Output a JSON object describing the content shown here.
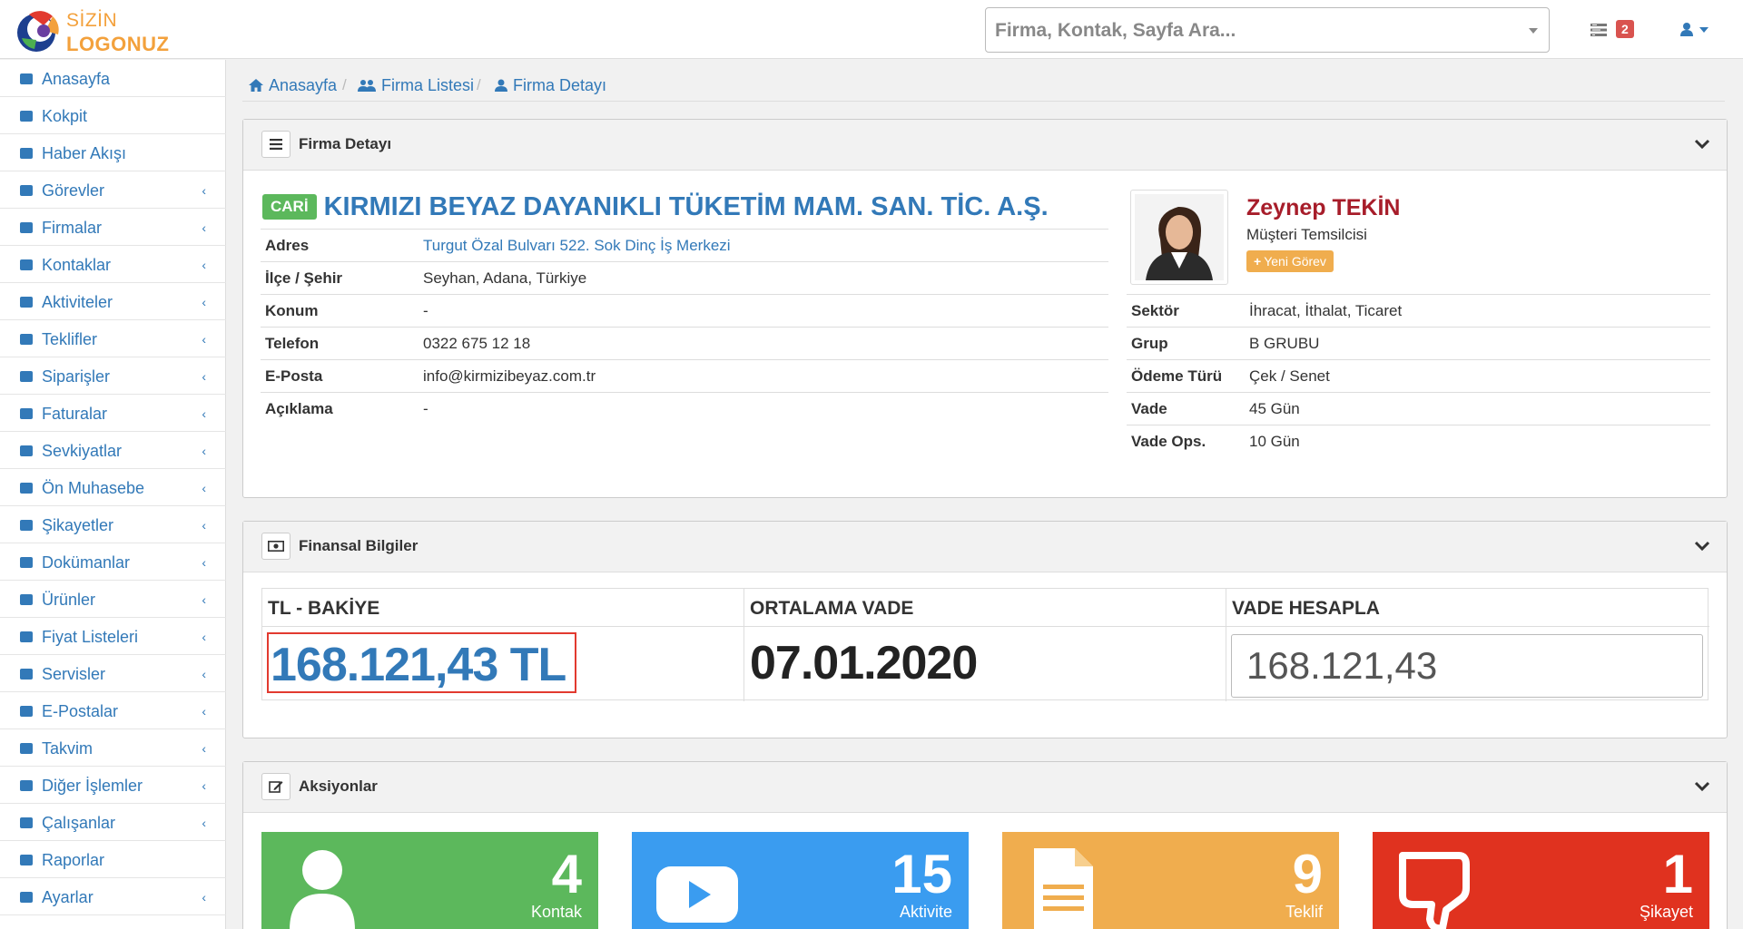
{
  "logo": {
    "line1": "SİZİN",
    "line2": "LOGONUZ"
  },
  "search": {
    "placeholder": "Firma, Kontak, Sayfa Ara..."
  },
  "notifications": {
    "count": "2"
  },
  "sidebar": {
    "items": [
      {
        "label": "Anasayfa",
        "icon": "home-icon",
        "sub": false
      },
      {
        "label": "Kokpit",
        "icon": "dashboard-icon",
        "sub": false
      },
      {
        "label": "Haber Akışı",
        "icon": "newspaper-icon",
        "sub": false
      },
      {
        "label": "Görevler",
        "icon": "tasks-icon",
        "sub": true
      },
      {
        "label": "Firmalar",
        "icon": "users-icon",
        "sub": true
      },
      {
        "label": "Kontaklar",
        "icon": "user-icon",
        "sub": true
      },
      {
        "label": "Aktiviteler",
        "icon": "youtube-play-icon",
        "sub": true
      },
      {
        "label": "Teklifler",
        "icon": "file-icon",
        "sub": true
      },
      {
        "label": "Siparişler",
        "icon": "list-alt-icon",
        "sub": true
      },
      {
        "label": "Faturalar",
        "icon": "list-icon",
        "sub": true
      },
      {
        "label": "Sevkiyatlar",
        "icon": "truck-icon",
        "sub": true
      },
      {
        "label": "Ön Muhasebe",
        "icon": "bars-icon",
        "sub": true
      },
      {
        "label": "Şikayetler",
        "icon": "thumbs-down-icon",
        "sub": true
      },
      {
        "label": "Dokümanlar",
        "icon": "document-icon",
        "sub": true
      },
      {
        "label": "Ürünler",
        "icon": "product-icon",
        "sub": true
      },
      {
        "label": "Fiyat Listeleri",
        "icon": "euro-icon",
        "sub": true
      },
      {
        "label": "Servisler",
        "icon": "wrench-icon",
        "sub": true
      },
      {
        "label": "E-Postalar",
        "icon": "envelope-icon",
        "sub": true
      },
      {
        "label": "Takvim",
        "icon": "calendar-icon",
        "sub": true
      },
      {
        "label": "Diğer İşlemler",
        "icon": "square-icon",
        "sub": true
      },
      {
        "label": "Çalışanlar",
        "icon": "employee-icon",
        "sub": true
      },
      {
        "label": "Raporlar",
        "icon": "bar-chart-icon",
        "sub": false
      },
      {
        "label": "Ayarlar",
        "icon": "gear-icon",
        "sub": true
      }
    ]
  },
  "breadcrumb": {
    "home": "Anasayfa",
    "list": "Firma Listesi",
    "detail": "Firma Detayı"
  },
  "detail_panel": {
    "title": "Firma Detayı",
    "badge": "CARİ",
    "company_name": "KIRMIZI BEYAZ DAYANIKLI TÜKETİM MAM. SAN. TİC. A.Ş.",
    "fields": [
      {
        "key": "Adres",
        "value": "Turgut Özal Bulvarı 522. Sok Dinç İş Merkezi"
      },
      {
        "key": "İlçe / Şehir",
        "value": "Seyhan, Adana, Türkiye"
      },
      {
        "key": "Konum",
        "value": "-"
      },
      {
        "key": "Telefon",
        "value": "0322 675 12 18"
      },
      {
        "key": "E-Posta",
        "value": "info@kirmizibeyaz.com.tr"
      },
      {
        "key": "Açıklama",
        "value": "-"
      }
    ],
    "rep": {
      "name": "Zeynep TEKİN",
      "title": "Müşteri Temsilcisi",
      "button": "Yeni Görev"
    },
    "extra_fields": [
      {
        "key": "Sektör",
        "value": "İhracat, İthalat, Ticaret"
      },
      {
        "key": "Grup",
        "value": "B GRUBU"
      },
      {
        "key": "Ödeme Türü",
        "value": "Çek / Senet"
      },
      {
        "key": "Vade",
        "value": "45 Gün"
      },
      {
        "key": "Vade Ops.",
        "value": "10 Gün"
      }
    ]
  },
  "finance_panel": {
    "title": "Finansal Bilgiler",
    "balance_label": "TL - BAKİYE",
    "balance_value": "168.121,43 TL",
    "avg_label": "ORTALAMA VADE",
    "avg_value": "07.01.2020",
    "calc_label": "VADE HESAPLA",
    "calc_value": "168.121,43"
  },
  "actions_panel": {
    "title": "Aksiyonlar",
    "tiles": [
      {
        "count": "4",
        "label": "Kontak",
        "color": "#5cb85c"
      },
      {
        "count": "15",
        "label": "Aktivite",
        "color": "#3a9cf0"
      },
      {
        "count": "9",
        "label": "Teklif",
        "color": "#f0ad4e"
      },
      {
        "count": "1",
        "label": "Şikayet",
        "color": "#e0321f"
      }
    ]
  },
  "colors": {
    "link": "#3279b8",
    "success": "#5cb85c",
    "warning": "#f0ad4e",
    "danger": "#d9534f"
  }
}
